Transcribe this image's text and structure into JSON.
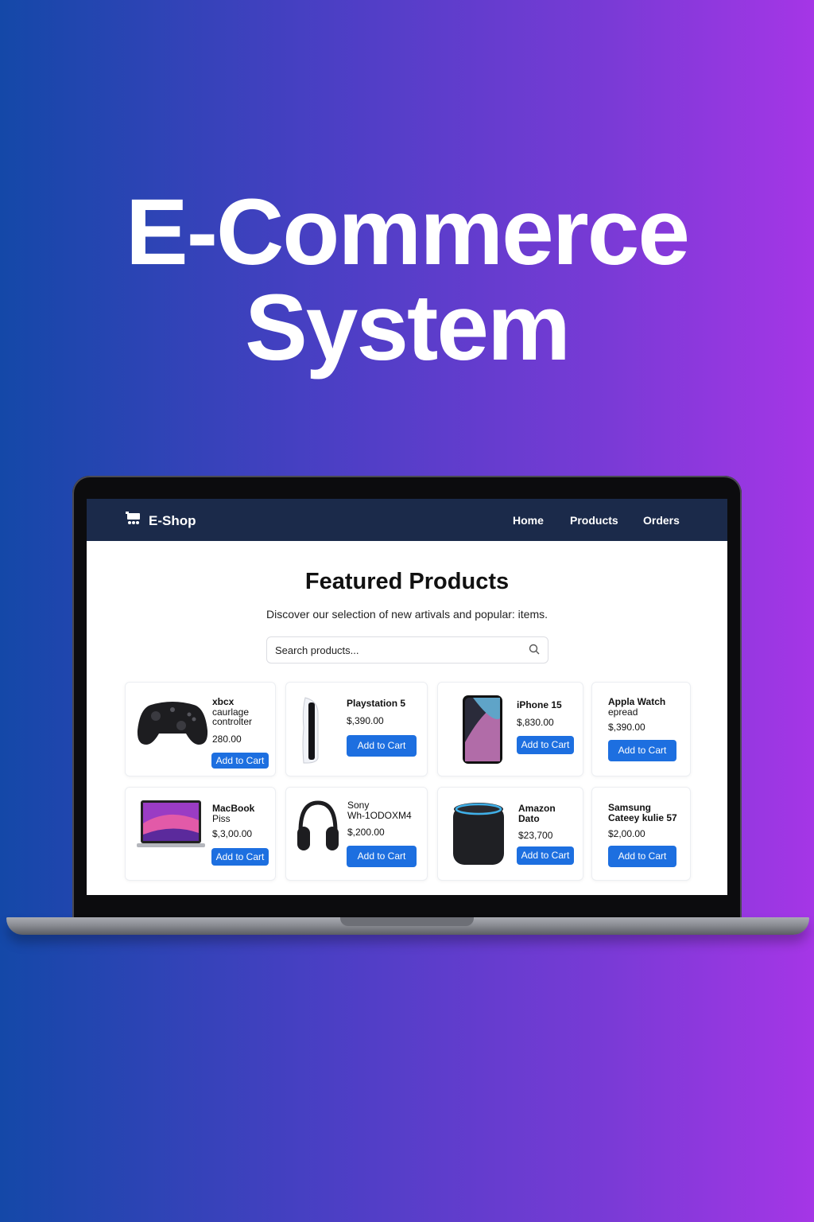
{
  "hero": {
    "line1": "E-Commerce",
    "line2": "System"
  },
  "navbar": {
    "brand": "E-Shop",
    "brand_icon": "cart-icon",
    "links": [
      "Home",
      "Products",
      "Orders"
    ]
  },
  "main": {
    "title": "Featured Products",
    "subtitle": "Discover our selection of new artivals and popular: items.",
    "search_placeholder": "Search products..."
  },
  "products": [
    {
      "name": "xbcx",
      "sub1": "caurlage",
      "sub2": "controlter",
      "price": "280.00",
      "button": "Add to Cart",
      "icon": "game-controller-icon"
    },
    {
      "name": "Playstation 5",
      "price": "$,390.00",
      "button": "Add to Cart",
      "icon": "console-icon"
    },
    {
      "name": "iPhone 15",
      "price": "$,830.00",
      "button": "Add to Cart",
      "icon": "phone-icon"
    },
    {
      "name": "Appla Watch",
      "sub1": "epread",
      "price": "$,390.00",
      "button": "Add to Cart",
      "icon": "watch-icon"
    },
    {
      "name": "MacBook",
      "sub1": "Piss",
      "price": "$,3,00.00",
      "button": "Add to Cart",
      "icon": "laptop-icon"
    },
    {
      "name": "Sony",
      "sub1": "Wh-1ODOXM4",
      "price": "$,200.00",
      "button": "Add to Cart",
      "icon": "headphones-icon"
    },
    {
      "name": "Amazon",
      "sub1": "Dato",
      "price": "$23,700",
      "button": "Add to Cart",
      "icon": "smart-speaker-icon"
    },
    {
      "name": "Samsung",
      "sub1": "Cateey kulie 57",
      "price": "$2,00.00",
      "button": "Add to Cart",
      "icon": "phone-icon"
    }
  ],
  "colors": {
    "navbar": "#1b2a4a",
    "accent": "#1d6fe0",
    "gradient_start": "#1448a8",
    "gradient_end": "#a536e6"
  }
}
